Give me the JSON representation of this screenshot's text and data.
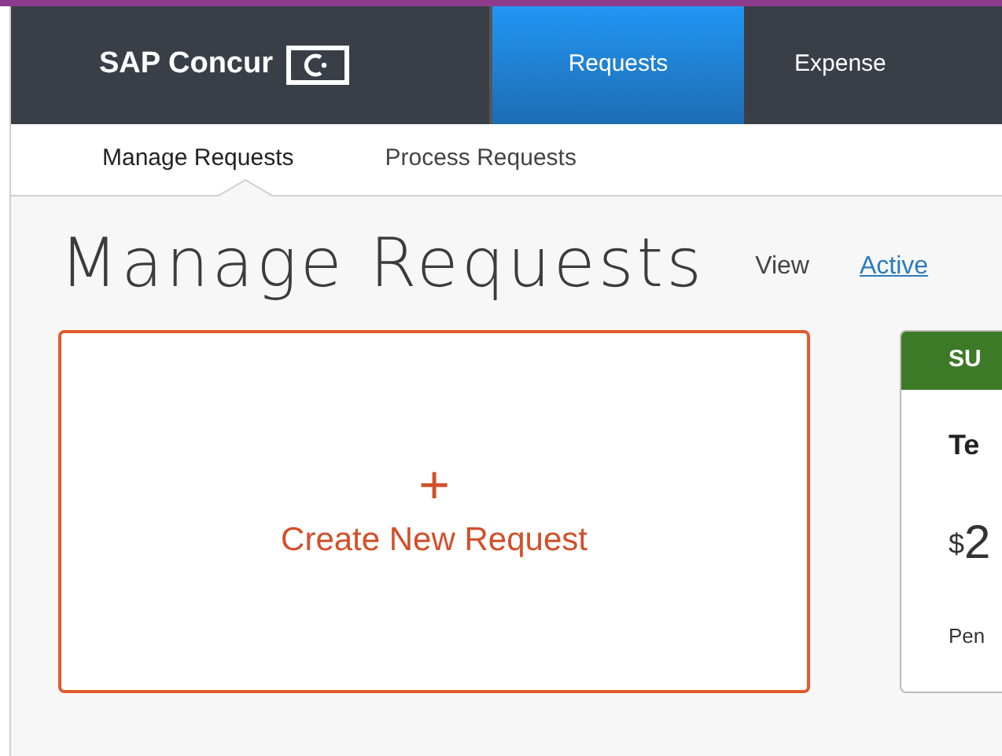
{
  "header": {
    "logo": "SAP Concur",
    "tabs": [
      {
        "label": "Requests",
        "selected": true
      },
      {
        "label": "Expense",
        "selected": false
      }
    ]
  },
  "subnav": [
    {
      "label": "Manage Requests",
      "selected": true
    },
    {
      "label": "Process Requests",
      "selected": false
    }
  ],
  "page": {
    "title": "Manage Requests",
    "view_label": "View",
    "view_link": "Active"
  },
  "create_card": {
    "icon": "+",
    "label": "Create New Request"
  },
  "request_card": {
    "status": "SU",
    "name": "Te",
    "currency": "$",
    "amount": "2",
    "footer": "Pen"
  }
}
